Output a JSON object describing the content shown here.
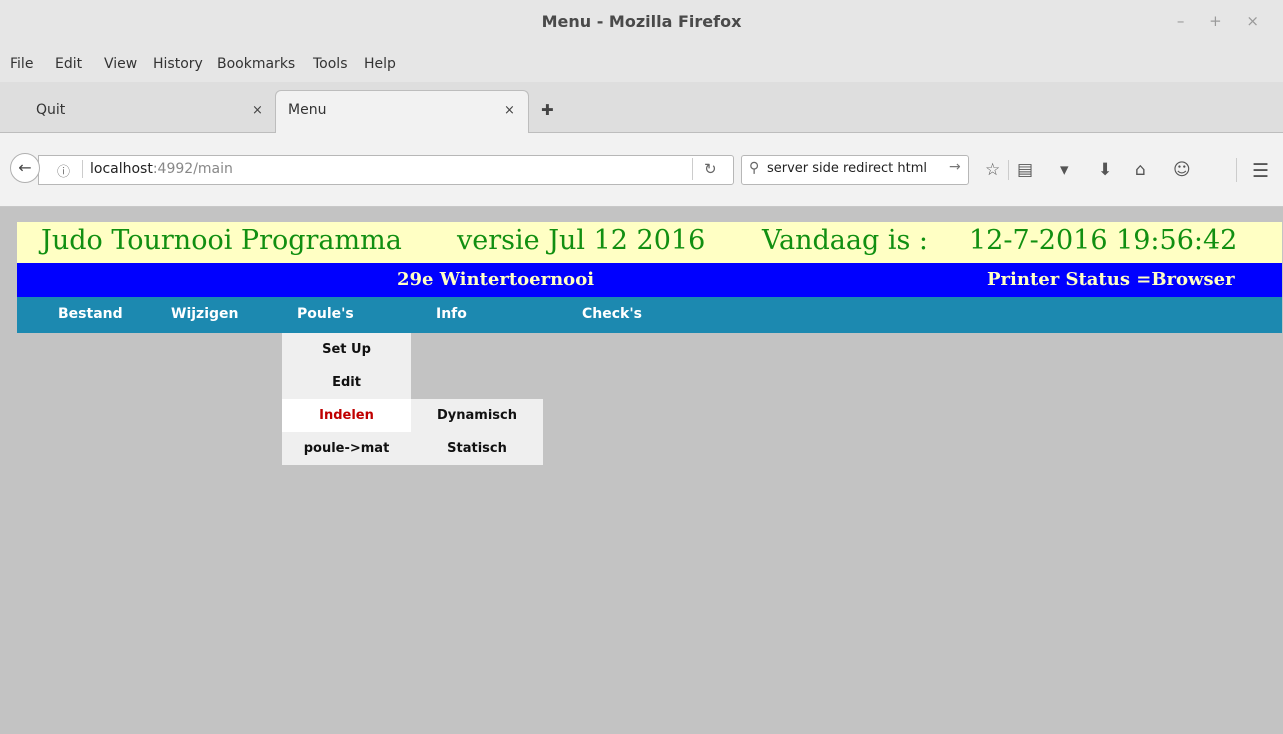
{
  "window": {
    "title": "Menu - Mozilla Firefox",
    "controls": "– + ×"
  },
  "menubar": [
    "File",
    "Edit",
    "View",
    "History",
    "Bookmarks",
    "Tools",
    "Help"
  ],
  "tabs": [
    {
      "label": "Quit",
      "close": "×"
    },
    {
      "label": "Menu",
      "close": "×"
    }
  ],
  "new_tab": "✚",
  "nav": {
    "back": "←",
    "info": "ⓘ",
    "url_host": "localhost",
    "url_rest": ":4992/main",
    "reload": "↻",
    "search_icon": "⚲",
    "search_text": "server side redirect html",
    "search_go": "→",
    "icons": [
      "☆",
      "▤",
      "▾",
      "⬇",
      "⌂",
      "☺",
      "☰"
    ]
  },
  "page": {
    "header": {
      "title": "Judo Tournooi Programma",
      "version": "versie Jul 12 2016",
      "today_label": "Vandaag is :",
      "datetime": "12-7-2016 19:56:42"
    },
    "tournament": "29e Wintertoernooi",
    "printer_status": "Printer Status =Browser",
    "nav_items": [
      "Bestand",
      "Wijzigen",
      "Poule's",
      "Info",
      "Check's"
    ],
    "dropdown": [
      "Set Up",
      "Edit",
      "Indelen",
      "poule->mat"
    ],
    "submenu": [
      "Dynamisch",
      "Statisch"
    ]
  },
  "colors": {
    "header_bg": "#ffffc4",
    "header_text": "#118f11",
    "banner_bg": "#0000ff",
    "nav_bg": "#1c89b0",
    "highlight": "#c00000",
    "page_bg": "#c3c3c3"
  }
}
